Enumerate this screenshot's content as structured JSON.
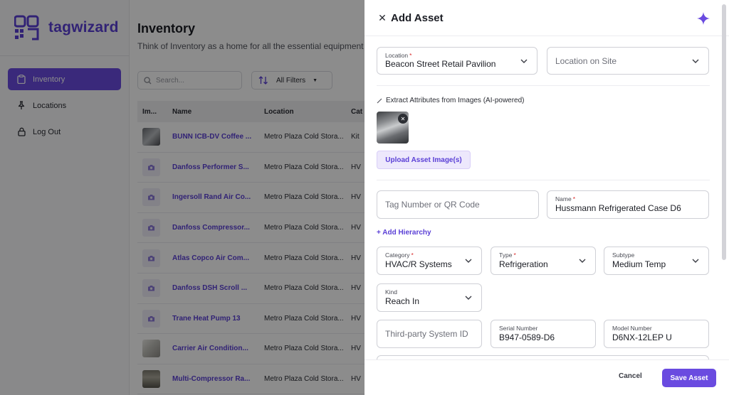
{
  "app": {
    "logo_text": "tagwizard"
  },
  "sidebar": {
    "items": [
      {
        "label": "Inventory",
        "icon": "clipboard-icon"
      },
      {
        "label": "Locations",
        "icon": "pin-icon"
      },
      {
        "label": "Log Out",
        "icon": "logout-icon"
      }
    ]
  },
  "inventory": {
    "title": "Inventory",
    "subtitle": "Think of Inventory as a home for all the essential equipment",
    "search_placeholder": "Search...",
    "filters_label": "All Filters",
    "columns": [
      "Im...",
      "Name",
      "Location",
      "Cat"
    ],
    "rows": [
      {
        "name": "BUNN ICB-DV Coffee ...",
        "location": "Metro Plaza Cold Stora...",
        "category": "Kit",
        "image": "photo"
      },
      {
        "name": "Danfoss Performer S...",
        "location": "Metro Plaza Cold Stora...",
        "category": "HV",
        "image": "camera"
      },
      {
        "name": "Ingersoll Rand Air Co...",
        "location": "Metro Plaza Cold Stora...",
        "category": "HV",
        "image": "camera"
      },
      {
        "name": "Danfoss Compressor...",
        "location": "Metro Plaza Cold Stora...",
        "category": "HV",
        "image": "camera"
      },
      {
        "name": "Atlas Copco Air Com...",
        "location": "Metro Plaza Cold Stora...",
        "category": "HV",
        "image": "camera"
      },
      {
        "name": "Danfoss DSH Scroll ...",
        "location": "Metro Plaza Cold Stora...",
        "category": "HV",
        "image": "camera"
      },
      {
        "name": "Trane Heat Pump 13",
        "location": "Metro Plaza Cold Stora...",
        "category": "HV",
        "image": "camera"
      },
      {
        "name": "Carrier Air Condition...",
        "location": "Metro Plaza Cold Stora...",
        "category": "HV",
        "image": "paper"
      },
      {
        "name": "Multi-Compressor Ra...",
        "location": "Metro Plaza Cold Stora...",
        "category": "HV",
        "image": "shelf"
      }
    ]
  },
  "drawer": {
    "title": "Add Asset",
    "location": {
      "label": "Location",
      "required_mark": "*",
      "value": "Beacon Street Retail Pavilion"
    },
    "location_on_site": {
      "placeholder": "Location on Site"
    },
    "extract_label": "Extract Attributes from Images (AI-powered)",
    "upload_button": "Upload Asset Image(s)",
    "tag_number": {
      "placeholder": "Tag Number or QR Code"
    },
    "name": {
      "label": "Name",
      "required_mark": "*",
      "value": "Hussmann Refrigerated Case D6"
    },
    "add_hierarchy": "+ Add Hierarchy",
    "category": {
      "label": "Category",
      "required_mark": "*",
      "value": "HVAC/R Systems"
    },
    "type": {
      "label": "Type",
      "required_mark": "*",
      "value": "Refrigeration"
    },
    "subtype": {
      "label": "Subtype",
      "value": "Medium Temp"
    },
    "kind": {
      "label": "Kind",
      "value": "Reach In"
    },
    "third_party": {
      "placeholder": "Third-party System ID"
    },
    "serial": {
      "label": "Serial Number",
      "value": "B947-0589-D6"
    },
    "model": {
      "label": "Model Number",
      "value": "D6NX-12LEP U"
    },
    "cancel_label": "Cancel",
    "save_label": "Save Asset"
  },
  "colors": {
    "accent": "#6a4be0",
    "overlay": "rgba(0,0,0,0.45)",
    "required": "#d92c2c"
  }
}
